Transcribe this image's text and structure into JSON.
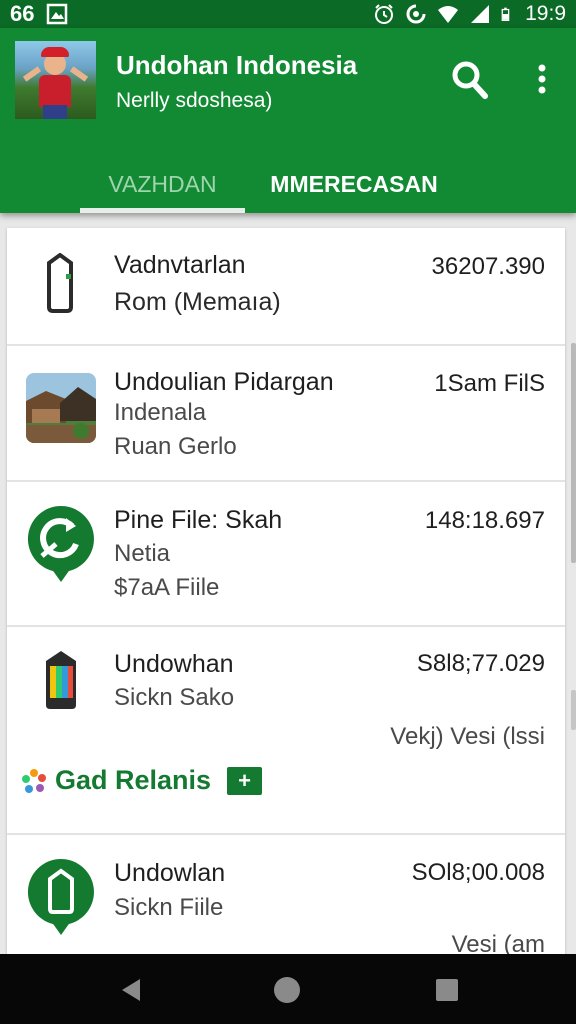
{
  "status_bar": {
    "left_text": "66",
    "time": "19:9",
    "icons": [
      "gallery-icon",
      "alarm-icon",
      "data-saver-icon",
      "wifi-icon",
      "signal-icon",
      "battery-icon"
    ]
  },
  "app_bar": {
    "title": "Undohan Indonesia",
    "subtitle": "Nerlly sdoshesa)",
    "icons": [
      "search-icon",
      "more-vert-icon"
    ],
    "color": "#128a34"
  },
  "tabs": [
    {
      "label": "VAZHDAN",
      "selected": true
    },
    {
      "label": "MMERECASAN",
      "selected": false
    }
  ],
  "list": {
    "items": [
      {
        "icon": "phone-icon",
        "title": "Vadnvtarlan",
        "line2": "Rom (Memaıa)",
        "line3": "",
        "value": "36207.390",
        "value2": ""
      },
      {
        "icon": "village-photo-thumbnail",
        "title": "Undoulian Pidargan",
        "line2": "Indenala",
        "line3": "Ruan Gerlo",
        "value": "1Sam FilS",
        "value2": ""
      },
      {
        "icon": "refresh-pin-icon",
        "title": "Pine File: Skah",
        "line2": "Netia",
        "line3": "$7aA Fiile",
        "value": "148:18.697",
        "value2": ""
      },
      {
        "icon": "colorful-phone-icon",
        "title": "Undowhan",
        "line2": "Sickn Sako",
        "line3": "",
        "value": "S8l8;77.029",
        "value2": "Vekj)  Vesi (lssi"
      },
      {
        "icon": "phone-pin-icon",
        "title": "Undowlan",
        "line2": "Sickn Fiile",
        "line3": "",
        "value": "SOl8;00.008",
        "value2": "Vesi (am"
      }
    ],
    "promo": {
      "label": "Gad Relanis",
      "button": "+",
      "icon": "pinwheel-icon"
    }
  },
  "nav_bar": {
    "icons": [
      "back-icon",
      "home-icon",
      "recents-icon"
    ]
  },
  "colors": {
    "accent": "#157a31",
    "status_bar": "#0b6b26"
  }
}
